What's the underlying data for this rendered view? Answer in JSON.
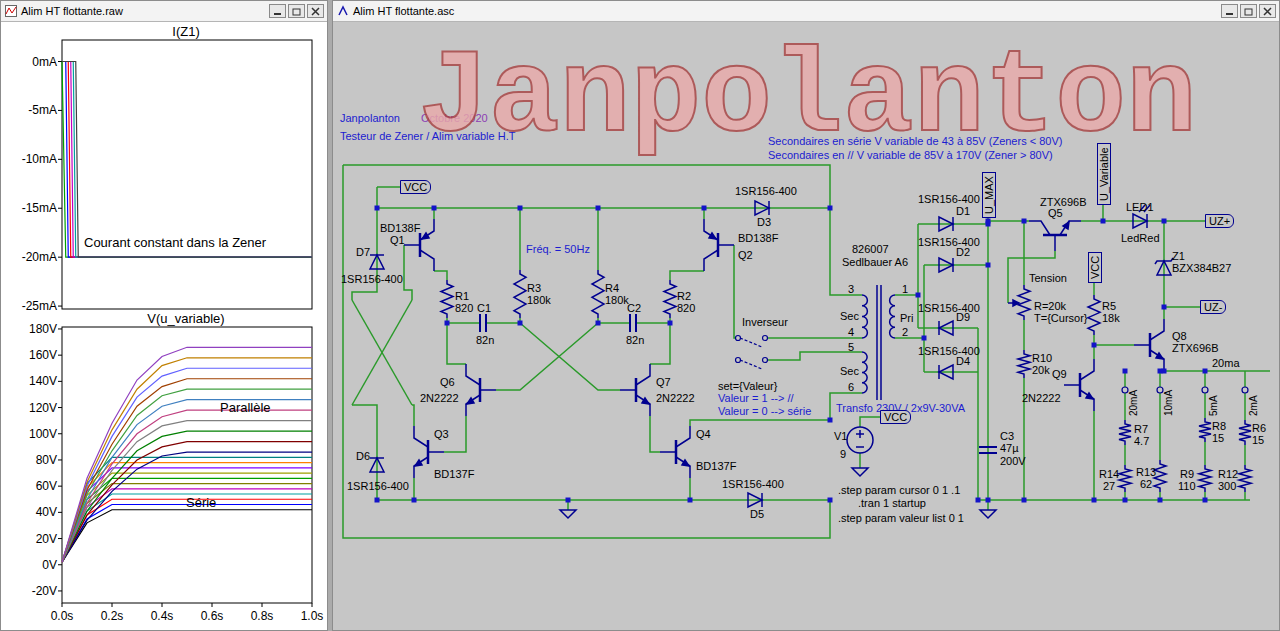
{
  "windows": {
    "waveform_title": "Alim HT flottante.raw",
    "schematic_title": "Alim HT flottante.asc"
  },
  "watermark": "Janpolanton",
  "waveform": {
    "plots": [
      {
        "title": "I(Z1)",
        "y_max": 2.2,
        "y_min": -25.3,
        "y_ticks": [
          {
            "label": "0mA",
            "value": 0
          },
          {
            "label": "-5mA",
            "value": -5
          },
          {
            "label": "-10mA",
            "value": -10
          },
          {
            "label": "-15mA",
            "value": -15
          },
          {
            "label": "-20mA",
            "value": -20
          },
          {
            "label": "-25mA",
            "value": -25
          }
        ],
        "x_ticks": [],
        "annotations": [
          "Courant constant dans la Zener"
        ],
        "t": [
          0,
          0.015,
          0.025,
          0.035,
          0.045,
          0.055,
          0.065,
          1.0
        ],
        "series": [
          {
            "color": "#00a000",
            "values": [
              0,
              -20,
              -20,
              -20,
              -20,
              -20,
              -20,
              -20
            ]
          },
          {
            "color": "#0000ff",
            "values": [
              0,
              0,
              -20,
              -20,
              -20,
              -20,
              -20,
              -20
            ]
          },
          {
            "color": "#ff0000",
            "values": [
              0,
              0,
              0,
              -20,
              -20,
              -20,
              -20,
              -20
            ]
          },
          {
            "color": "#c000c0",
            "values": [
              0,
              0,
              0,
              0,
              -20,
              -20,
              -20,
              -20
            ]
          },
          {
            "color": "#00a0a0",
            "values": [
              0,
              0,
              0,
              0,
              0,
              -20,
              -20,
              -20
            ]
          },
          {
            "color": "#404040",
            "values": [
              0,
              0,
              0,
              0,
              0,
              0,
              -20,
              -20
            ]
          }
        ]
      },
      {
        "title": "V(u_variable)",
        "y_max": 181.5,
        "y_min": -29.2,
        "y_ticks": [
          {
            "label": "180V",
            "value": 180
          },
          {
            "label": "160V",
            "value": 160
          },
          {
            "label": "140V",
            "value": 140
          },
          {
            "label": "120V",
            "value": 120
          },
          {
            "label": "100V",
            "value": 100
          },
          {
            "label": "80V",
            "value": 80
          },
          {
            "label": "60V",
            "value": 60
          },
          {
            "label": "40V",
            "value": 40
          },
          {
            "label": "20V",
            "value": 20
          },
          {
            "label": "0V",
            "value": 0
          },
          {
            "label": "-20V",
            "value": -20
          }
        ],
        "x_ticks": [
          {
            "label": "0.0s",
            "value": 0
          },
          {
            "label": "0.2s",
            "value": 0.2
          },
          {
            "label": "0.4s",
            "value": 0.4
          },
          {
            "label": "0.6s",
            "value": 0.6
          },
          {
            "label": "0.8s",
            "value": 0.8
          },
          {
            "label": "1.0s",
            "value": 1.0
          }
        ],
        "annotations": [
          "Parallèle",
          "Série"
        ],
        "t": [
          0,
          0.1,
          0.2,
          0.3,
          0.4,
          0.5,
          0.6,
          0.7,
          0.8,
          0.9,
          1.0
        ],
        "series": [
          {
            "color": "#000000",
            "values": [
              2,
              32,
              42,
              42,
              42,
              42,
              42,
              42,
              42,
              42,
              42
            ]
          },
          {
            "color": "#0000ff",
            "values": [
              2,
              35,
              46,
              46,
              46,
              46,
              46,
              46,
              46,
              46,
              46
            ]
          },
          {
            "color": "#ff0000",
            "values": [
              2,
              38,
              50,
              50,
              50,
              50,
              50,
              50,
              50,
              50,
              50
            ]
          },
          {
            "color": "#00a0a0",
            "values": [
              2,
              41,
              54,
              54,
              54,
              54,
              54,
              54,
              54,
              54,
              54
            ]
          },
          {
            "color": "#c000c0",
            "values": [
              2,
              44,
              58,
              58,
              58,
              58,
              58,
              58,
              58,
              58,
              58
            ]
          },
          {
            "color": "#808000",
            "values": [
              2,
              47,
              62,
              62,
              62,
              62,
              62,
              62,
              62,
              62,
              62
            ]
          },
          {
            "color": "#00a000",
            "values": [
              2,
              50,
              66,
              66,
              66,
              66,
              66,
              66,
              66,
              66,
              66
            ]
          },
          {
            "color": "#a0a000",
            "values": [
              2,
              53,
              70,
              70,
              70,
              70,
              70,
              70,
              70,
              70,
              70
            ]
          },
          {
            "color": "#8000ff",
            "values": [
              2,
              56,
              74,
              74,
              74,
              74,
              74,
              74,
              74,
              74,
              74
            ]
          },
          {
            "color": "#ff8000",
            "values": [
              2,
              59,
              78,
              78,
              78,
              78,
              78,
              78,
              78,
              78,
              78
            ]
          },
          {
            "color": "#008080",
            "values": [
              2,
              62,
              82,
              82,
              82,
              82,
              82,
              82,
              82,
              82,
              82
            ]
          },
          {
            "color": "#000080",
            "values": [
              2,
              34,
              56,
              73,
              83,
              86,
              86,
              86,
              86,
              86,
              86
            ]
          },
          {
            "color": "#800000",
            "values": [
              2,
              38,
              61,
              80,
              90,
              94,
              94,
              94,
              94,
              94,
              94
            ]
          },
          {
            "color": "#008000",
            "values": [
              2,
              41,
              66,
              87,
              98,
              102,
              102,
              102,
              102,
              102,
              102
            ]
          },
          {
            "color": "#808080",
            "values": [
              2,
              44,
              72,
              94,
              106,
              110,
              110,
              110,
              110,
              110,
              110
            ]
          },
          {
            "color": "#c04080",
            "values": [
              2,
              47,
              77,
              100,
              113,
              118,
              118,
              118,
              118,
              118,
              118
            ]
          },
          {
            "color": "#4080c0",
            "values": [
              2,
              50,
              82,
              107,
              121,
              126,
              126,
              126,
              126,
              126,
              126
            ]
          },
          {
            "color": "#40a040",
            "values": [
              2,
              54,
              87,
              114,
              129,
              134,
              134,
              134,
              134,
              134,
              134
            ]
          },
          {
            "color": "#a04000",
            "values": [
              2,
              57,
              92,
              121,
              136,
              142,
              142,
              142,
              142,
              142,
              142
            ]
          },
          {
            "color": "#6060ff",
            "values": [
              2,
              60,
              98,
              128,
              144,
              150,
              150,
              150,
              150,
              150,
              150
            ]
          },
          {
            "color": "#c08000",
            "values": [
              2,
              63,
              103,
              134,
              152,
              158,
              158,
              158,
              158,
              158,
              158
            ]
          },
          {
            "color": "#9040c0",
            "values": [
              2,
              66,
              108,
              141,
              159,
              166,
              166,
              166,
              166,
              166,
              166
            ]
          }
        ]
      }
    ]
  },
  "schematic": {
    "labels": [
      {
        "text": "Janpolanton",
        "kind": "comment"
      },
      {
        "text": "Octobre 2020",
        "kind": "date"
      },
      {
        "text": "Testeur de Zener / Alim variable H.T",
        "kind": "comment"
      },
      {
        "text": "Secondaires en série V variable de 43 à 85V (Zeners < 80V)",
        "kind": "comment"
      },
      {
        "text": "Secondaires en // V variable de 85V à 170V (Zener > 80V)",
        "kind": "comment"
      },
      {
        "text": "Fréq. = 50Hz",
        "kind": "comment"
      },
      {
        "text": "BD138F",
        "kind": "part"
      },
      {
        "text": "Q1",
        "kind": "part"
      },
      {
        "text": "D7",
        "kind": "part"
      },
      {
        "text": "1SR156-400",
        "kind": "part"
      },
      {
        "text": "R1",
        "kind": "part"
      },
      {
        "text": "820",
        "kind": "part"
      },
      {
        "text": "R3",
        "kind": "part"
      },
      {
        "text": "180k",
        "kind": "part"
      },
      {
        "text": "R4",
        "kind": "part"
      },
      {
        "text": "180k",
        "kind": "part"
      },
      {
        "text": "R2",
        "kind": "part"
      },
      {
        "text": "820",
        "kind": "part"
      },
      {
        "text": "C1",
        "kind": "part"
      },
      {
        "text": "82n",
        "kind": "part"
      },
      {
        "text": "C2",
        "kind": "part"
      },
      {
        "text": "82n",
        "kind": "part"
      },
      {
        "text": "BD138F",
        "kind": "part"
      },
      {
        "text": "Q2",
        "kind": "part"
      },
      {
        "text": "1SR156-400",
        "kind": "part"
      },
      {
        "text": "D3",
        "kind": "part"
      },
      {
        "text": "Q6",
        "kind": "part"
      },
      {
        "text": "2N2222",
        "kind": "part"
      },
      {
        "text": "Q7",
        "kind": "part"
      },
      {
        "text": "2N2222",
        "kind": "part"
      },
      {
        "text": "Q3",
        "kind": "part"
      },
      {
        "text": "BD137F",
        "kind": "part"
      },
      {
        "text": "Q4",
        "kind": "part"
      },
      {
        "text": "BD137F",
        "kind": "part"
      },
      {
        "text": "D6",
        "kind": "part"
      },
      {
        "text": "1SR156-400",
        "kind": "part"
      },
      {
        "text": "1SR156-400",
        "kind": "part"
      },
      {
        "text": "D5",
        "kind": "part"
      },
      {
        "text": "Inverseur",
        "kind": "part"
      },
      {
        "text": "set={Valeur}",
        "kind": "part"
      },
      {
        "text": "Valeur = 1 --> //",
        "kind": "comment"
      },
      {
        "text": "Valeur = 0 --> série",
        "kind": "comment"
      },
      {
        "text": "826007",
        "kind": "part"
      },
      {
        "text": "Sedlbauer A6",
        "kind": "part"
      },
      {
        "text": "3",
        "kind": "pin"
      },
      {
        "text": "4",
        "kind": "pin"
      },
      {
        "text": "5",
        "kind": "pin"
      },
      {
        "text": "6",
        "kind": "pin"
      },
      {
        "text": "1",
        "kind": "pin"
      },
      {
        "text": "2",
        "kind": "pin"
      },
      {
        "text": "Sec",
        "kind": "part"
      },
      {
        "text": "Pri",
        "kind": "part"
      },
      {
        "text": "Sec",
        "kind": "part"
      },
      {
        "text": "Transfo 230V / 2x9V-30VA",
        "kind": "comment"
      },
      {
        "text": "V1",
        "kind": "part"
      },
      {
        "text": "9",
        "kind": "part"
      },
      {
        "text": ".step param cursor 0 1 .1",
        "kind": "directive"
      },
      {
        "text": ".tran 1 startup",
        "kind": "directive"
      },
      {
        "text": ".step param valeur list 0 1",
        "kind": "directive"
      },
      {
        "text": "1SR156-400",
        "kind": "part"
      },
      {
        "text": "D1",
        "kind": "part"
      },
      {
        "text": "1SR156-400",
        "kind": "part"
      },
      {
        "text": "D2",
        "kind": "part"
      },
      {
        "text": "1SR156-400",
        "kind": "part"
      },
      {
        "text": "D9",
        "kind": "part"
      },
      {
        "text": "1SR156-400",
        "kind": "part"
      },
      {
        "text": "D4",
        "kind": "part"
      },
      {
        "text": "C3",
        "kind": "part"
      },
      {
        "text": "47µ",
        "kind": "part"
      },
      {
        "text": "200V",
        "kind": "part"
      },
      {
        "text": "ZTX696B",
        "kind": "part"
      },
      {
        "text": "Q5",
        "kind": "part"
      },
      {
        "text": "LED1",
        "kind": "part"
      },
      {
        "text": "LedRed",
        "kind": "part"
      },
      {
        "text": "Tension",
        "kind": "part"
      },
      {
        "text": "R=20k",
        "kind": "part"
      },
      {
        "text": "T={Cursor}",
        "kind": "part"
      },
      {
        "text": "R10",
        "kind": "part"
      },
      {
        "text": "20k",
        "kind": "part"
      },
      {
        "text": "R5",
        "kind": "part"
      },
      {
        "text": "18k",
        "kind": "part"
      },
      {
        "text": "Z1",
        "kind": "part"
      },
      {
        "text": "BZX384B27",
        "kind": "part"
      },
      {
        "text": "Q8",
        "kind": "part"
      },
      {
        "text": "ZTX696B",
        "kind": "part"
      },
      {
        "text": "Q9",
        "kind": "part"
      },
      {
        "text": "2N2222",
        "kind": "part"
      },
      {
        "text": "20ma",
        "kind": "part"
      },
      {
        "text": "20mA",
        "kind": "vertical"
      },
      {
        "text": "10mA",
        "kind": "vertical"
      },
      {
        "text": "5mA",
        "kind": "vertical"
      },
      {
        "text": "2mA",
        "kind": "vertical"
      },
      {
        "text": "R7",
        "kind": "part"
      },
      {
        "text": "4.7",
        "kind": "part"
      },
      {
        "text": "R14",
        "kind": "part"
      },
      {
        "text": "27",
        "kind": "part"
      },
      {
        "text": "R13",
        "kind": "part"
      },
      {
        "text": "62",
        "kind": "part"
      },
      {
        "text": "R8",
        "kind": "part"
      },
      {
        "text": "15",
        "kind": "part"
      },
      {
        "text": "R9",
        "kind": "part"
      },
      {
        "text": "110",
        "kind": "part"
      },
      {
        "text": "R6",
        "kind": "part"
      },
      {
        "text": "15",
        "kind": "part"
      },
      {
        "text": "R12",
        "kind": "part"
      },
      {
        "text": "300",
        "kind": "part"
      }
    ],
    "flags": [
      {
        "text": "VCC",
        "kind": "horizontal"
      },
      {
        "text": "VCC",
        "kind": "horizontal"
      },
      {
        "text": "U_MAX",
        "kind": "vertical"
      },
      {
        "text": "U_Variable",
        "kind": "vertical"
      },
      {
        "text": "VCC",
        "kind": "vertical"
      },
      {
        "text": "UZ+",
        "kind": "horizontal"
      },
      {
        "text": "UZ-",
        "kind": "horizontal"
      }
    ]
  }
}
